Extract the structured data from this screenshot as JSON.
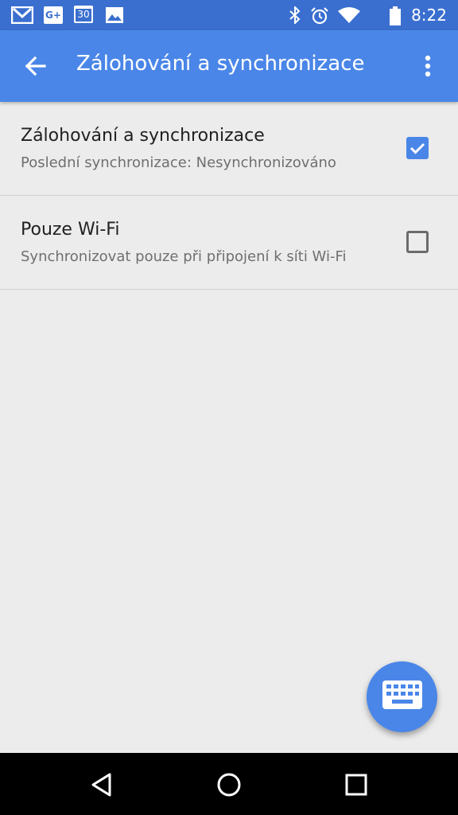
{
  "status_bar": {
    "time": "8:22",
    "notification_icons": [
      "gmail-icon",
      "google-plus-icon",
      "calendar-icon",
      "photos-icon"
    ],
    "calendar_day": "30",
    "google_plus_label": "G+",
    "system_icons": [
      "bluetooth-icon",
      "alarm-icon",
      "wifi-icon",
      "battery-icon"
    ]
  },
  "app_bar": {
    "title": "Zálohování a synchronizace",
    "back_icon": "arrow-back-icon",
    "overflow_icon": "more-vert-icon"
  },
  "settings": [
    {
      "title": "Zálohování a synchronizace",
      "summary": "Poslední synchronizace: Nesynchronizováno",
      "checked": true
    },
    {
      "title": "Pouze Wi-Fi",
      "summary": "Synchronizovat pouze při připojení k síti Wi-Fi",
      "checked": false
    }
  ],
  "fab": {
    "icon": "keyboard-icon"
  },
  "nav_bar": {
    "icons": [
      "back-triangle-icon",
      "home-circle-icon",
      "recents-square-icon"
    ]
  },
  "colors": {
    "status_bar": "#3a6fcf",
    "app_bar": "#4a86e8",
    "background": "#ececec",
    "accent": "#4a86e8"
  }
}
